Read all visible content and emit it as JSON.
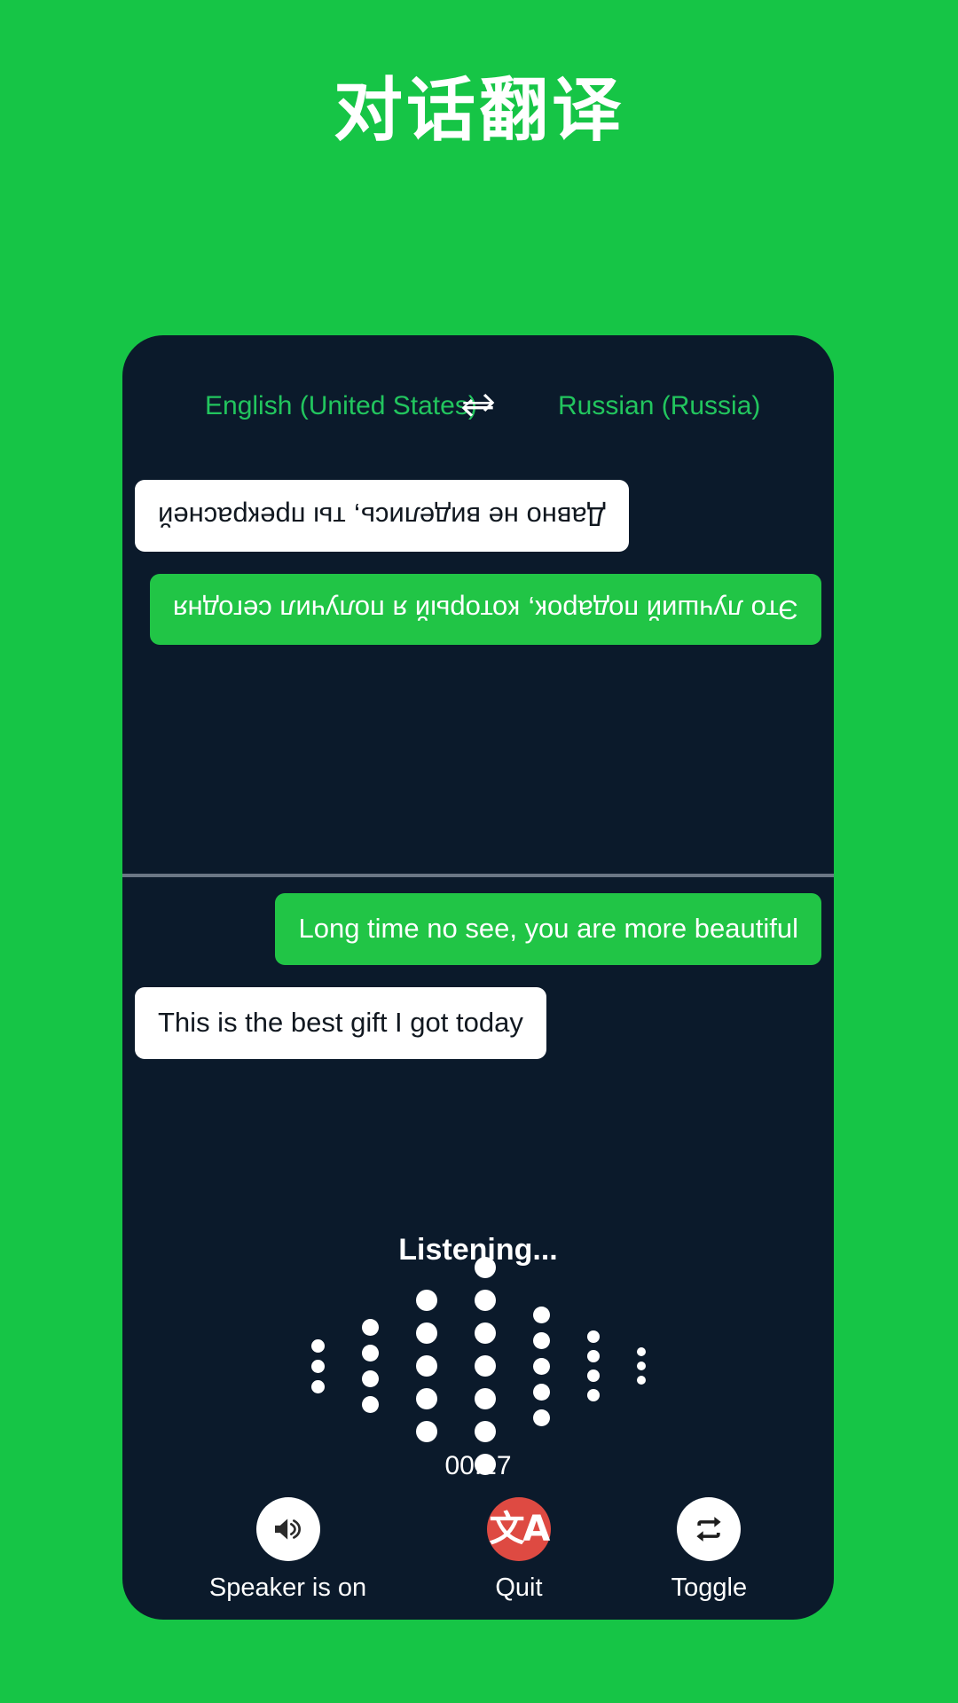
{
  "header": {
    "title": "对话翻译"
  },
  "language_bar": {
    "source_language": "English (United States)",
    "target_language": "Russian (Russia)",
    "swap_icon": "swap-horizontal-icon"
  },
  "conversation": {
    "top_panel_messages": [
      {
        "id": "ru-msg-1",
        "align": "left",
        "style": "green",
        "text": "Это лучший подарок, который я получил сегодня"
      },
      {
        "id": "ru-msg-2",
        "align": "right",
        "style": "white",
        "text": "Давно не виделись, ты прекрасней"
      }
    ],
    "bottom_panel_messages": [
      {
        "id": "en-msg-1",
        "align": "right",
        "style": "green",
        "text": "Long time no see, you are more beautiful"
      },
      {
        "id": "en-msg-2",
        "align": "left",
        "style": "white",
        "text": "This is the best gift I got today"
      }
    ]
  },
  "status": {
    "listening_label": "Listening...",
    "timer": "00:17"
  },
  "waveform": {
    "columns": [
      {
        "dots": 3,
        "size": 15
      },
      {
        "dots": 4,
        "size": 19
      },
      {
        "dots": 5,
        "size": 24
      },
      {
        "dots": 7,
        "size": 24
      },
      {
        "dots": 5,
        "size": 19
      },
      {
        "dots": 4,
        "size": 14
      },
      {
        "dots": 3,
        "size": 10
      }
    ],
    "gap": 14,
    "color": "#ffffff"
  },
  "controls": [
    {
      "id": "speaker",
      "label": "Speaker is on",
      "icon": "speaker-volume-icon",
      "circle_style": "white"
    },
    {
      "id": "quit",
      "label": "Quit",
      "icon": "translate-icon",
      "circle_style": "red"
    },
    {
      "id": "toggle",
      "label": "Toggle",
      "icon": "repeat-arrows-icon",
      "circle_style": "white"
    }
  ],
  "colors": {
    "background_green": "#16c546",
    "panel_dark": "#0b1a2b",
    "bubble_green": "#21c546",
    "bubble_white": "#ffffff",
    "accent_green_text": "#22c55e",
    "quit_red": "#de4a42",
    "divider_gray": "#6b7785"
  }
}
